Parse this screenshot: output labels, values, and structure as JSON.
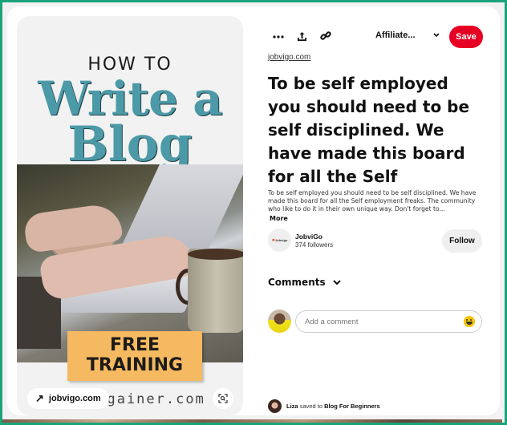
{
  "pin": {
    "image": {
      "headline_small": "HOW TO",
      "headline_line1": "Write a",
      "headline_line2": "Blog",
      "banner_line1": "FREE",
      "banner_line2": "TRAINING",
      "footer_text": "eygainer.com",
      "description": "Hands typing on a laptop beside a coffee mug"
    },
    "image_link": {
      "label": "jobvigo.com",
      "icon": "arrow-up-right-icon"
    },
    "visual_search_icon": "lens-icon"
  },
  "toolbar": {
    "more_icon": "ellipsis-icon",
    "share_icon": "share-upload-icon",
    "link_icon": "link-icon",
    "board_select": "Affiliate...",
    "board_chevron": "chevron-down-icon",
    "save_label": "Save",
    "save_color": "#e60023"
  },
  "source_link": "jobvigo.com",
  "title": "To be self employed you should need to be self disciplined. We have made this board for all the Self",
  "description": "To be self employed you should need to be self disciplined. We have made this board for all the Self employment freaks. The community who like to do it in their own unique way. Don't forget to...",
  "more_label": "More",
  "creator": {
    "avatar_text": "Jobvigo",
    "name": "JobviGo",
    "followers": "374 followers",
    "follow_label": "Follow"
  },
  "comments": {
    "heading": "Comments",
    "input_placeholder": "Add a comment",
    "input_value": ""
  },
  "saved_by": {
    "user": "Liza",
    "action": "saved to",
    "board": "Blog For Beginners"
  },
  "colors": {
    "frame_border": "#1aa37a",
    "title_teal": "#4c9aa8",
    "banner": "#f5b961"
  }
}
